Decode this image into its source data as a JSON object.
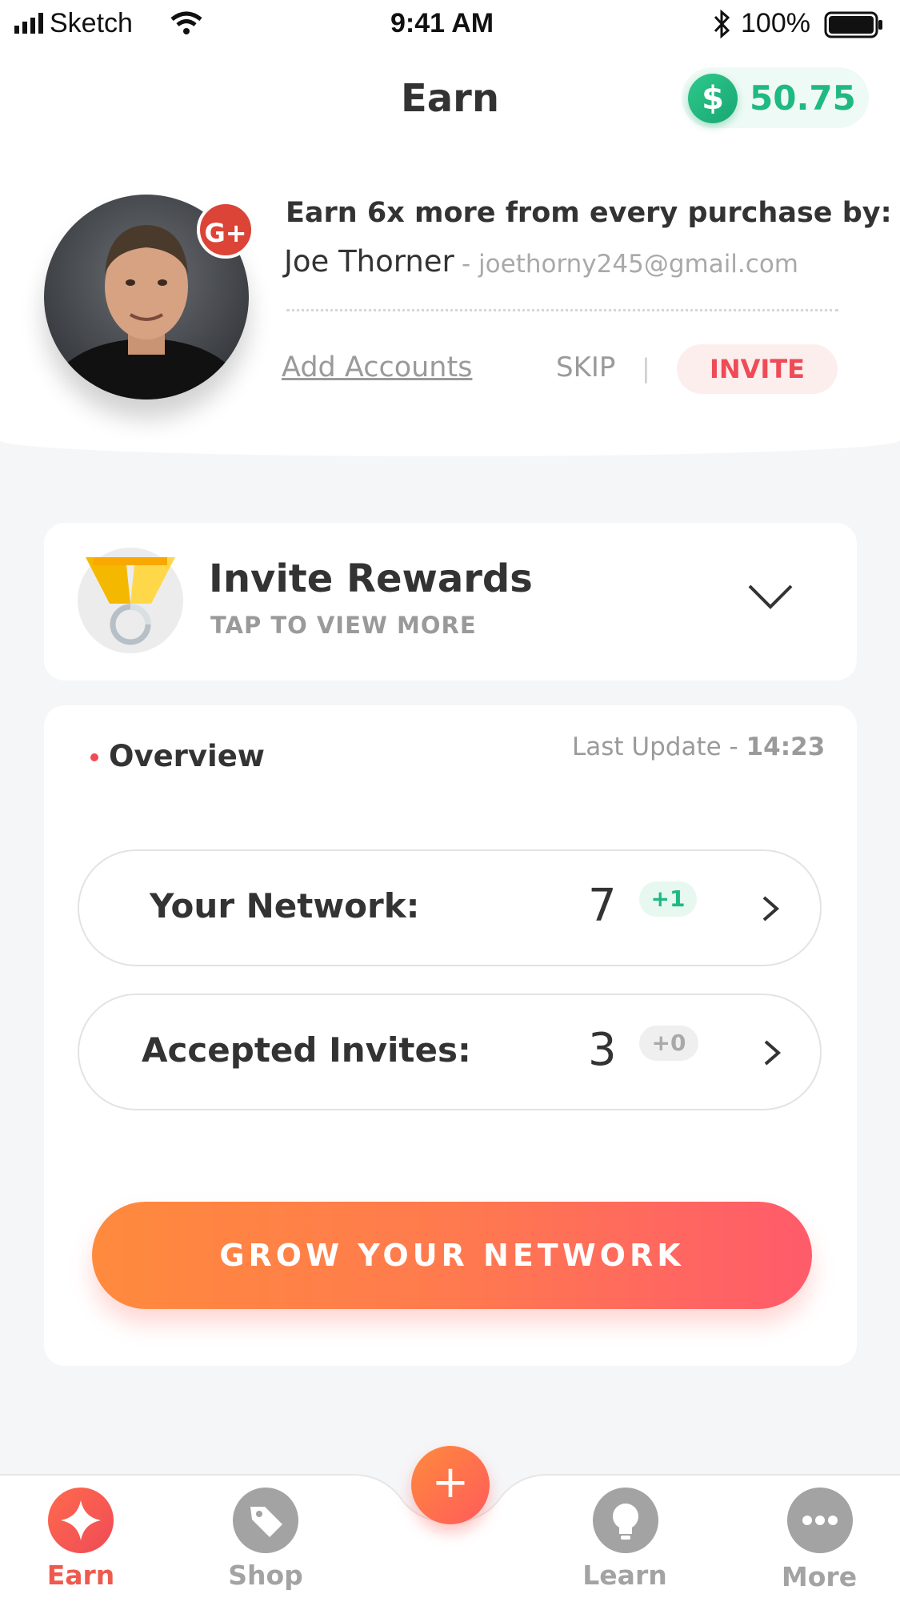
{
  "status_bar": {
    "carrier": "Sketch",
    "time": "9:41 AM",
    "battery": "100%"
  },
  "header": {
    "title": "Earn",
    "balance_symbol": "$",
    "balance": "50.75"
  },
  "account_prompt": {
    "heading": "Earn 6x more from every purchase by:",
    "name": "Joe Thorner",
    "email": "- joethorny245@gmail.com",
    "badge": "G+",
    "add_accounts": "Add Accounts",
    "skip": "SKIP",
    "divider": "|",
    "invite": "INVITE"
  },
  "rewards": {
    "title": "Invite Rewards",
    "subtitle": "TAP TO VIEW MORE"
  },
  "overview": {
    "label": "Overview",
    "last_update_prefix": "Last Update - ",
    "last_update_time": "14:23",
    "rows": [
      {
        "label": "Your Network:",
        "value": "7",
        "delta": "+1"
      },
      {
        "label": "Accepted Invites:",
        "value": "3",
        "delta": "+0"
      }
    ],
    "cta": "GROW YOUR NETWORK"
  },
  "tabs": [
    {
      "label": "Earn",
      "icon": "sparkle-icon",
      "active": true
    },
    {
      "label": "Shop",
      "icon": "tag-icon",
      "active": false
    },
    {
      "label": "Learn",
      "icon": "lightbulb-icon",
      "active": false
    },
    {
      "label": "More",
      "icon": "more-dots-icon",
      "active": false
    }
  ],
  "fab": {
    "label": "+"
  },
  "colors": {
    "accent_red": "#ef4b56",
    "accent_green": "#1fb981",
    "accent_orange": "#ff8a3d",
    "inactive_gray": "#a3a3a3"
  }
}
